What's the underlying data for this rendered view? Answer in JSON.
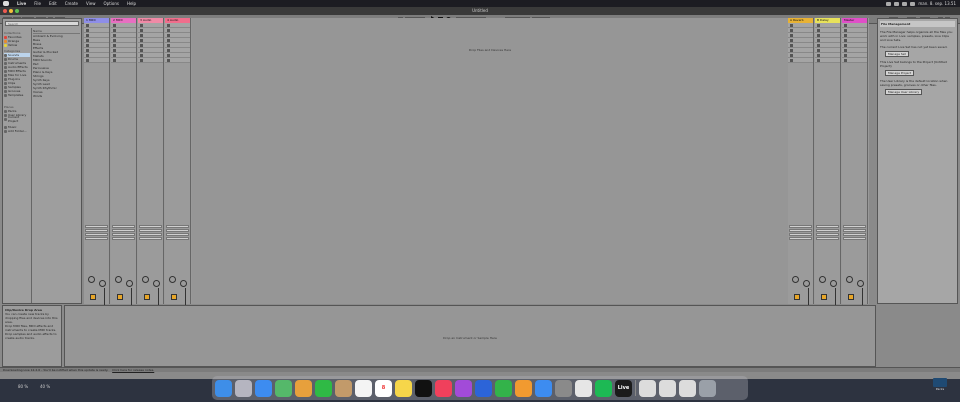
{
  "menubar": {
    "items": [
      "Live",
      "File",
      "Edit",
      "Create",
      "View",
      "Options",
      "Help"
    ],
    "clock": "man. 8. sep. 13.51"
  },
  "window": {
    "title": "Untitled"
  },
  "controlbar": {
    "link": "Link",
    "tap": "Tap",
    "tempo": "120.00",
    "signature": "4 / 4",
    "metronome": "1 Bar",
    "position": "1 . 1 . 1",
    "loop_start": "1 . 1 . 1",
    "loop_len": "4 . 0 . 0",
    "key": "Key",
    "midi": "MIDI",
    "cpu": "0 %"
  },
  "browser": {
    "search_placeholder": "Search",
    "collections_header": "Collections",
    "collections": [
      {
        "label": "Favorites",
        "color": "#e0453a"
      },
      {
        "label": "Orange",
        "color": "#e88b2c"
      },
      {
        "label": "Yellow",
        "color": "#e5d33b"
      }
    ],
    "categories_header": "Categories",
    "categories": [
      "Sounds",
      "Drums",
      "Instruments",
      "Audio Effects",
      "MIDI Effects",
      "Max for Live",
      "Plug-Ins",
      "Clips",
      "Samples",
      "Grooves",
      "Templates"
    ],
    "places_header": "Places",
    "places": [
      "Packs",
      "User Library",
      "Current Project"
    ],
    "places2": [
      "Music",
      "Add Folder..."
    ],
    "name_header": "Name",
    "names": [
      "Ambient & Evolving",
      "Bass",
      "Brass",
      "Effects",
      "Guitar & Plucked",
      "Mallets",
      "MIDI Sounds",
      "Pad",
      "Percussive",
      "Piano & Keys",
      "Strings",
      "Synth Keys",
      "Synth Lead",
      "Synth Rhythmic",
      "Voices",
      "Winds"
    ]
  },
  "tracks": [
    {
      "name": "1 MIDI",
      "color": "#8e8ee8"
    },
    {
      "name": "2 MIDI",
      "color": "#e86fc1"
    },
    {
      "name": "3 Audio",
      "color": "#f08aa6"
    },
    {
      "name": "4 Audio",
      "color": "#f06e8c"
    }
  ],
  "returns": [
    {
      "name": "A Reverb",
      "color": "#e8b234"
    },
    {
      "name": "B Delay",
      "color": "#e8e25a"
    }
  ],
  "master": {
    "name": "Master",
    "color": "#e04fc8"
  },
  "session": {
    "drop_text": "Drop Files and Devices Here",
    "scene_numbers": [
      "1",
      "2",
      "3",
      "4",
      "5",
      "6",
      "7",
      "8"
    ]
  },
  "mixer": {
    "midi_from": "MIDI From",
    "audio_from": "Audio From",
    "all_ins": "All Ins",
    "all_channels": "All Channels",
    "monitor": [
      "In",
      "Auto",
      "Off"
    ],
    "audio_to": "Audio To",
    "master_label": "Master",
    "sends": "Sends",
    "track_numbers": [
      "1",
      "2",
      "3",
      "4"
    ],
    "return_letters": [
      "A",
      "B"
    ],
    "solo": "S",
    "db_values": [
      "-inf",
      "0",
      "-inf",
      "0"
    ]
  },
  "file_manager": {
    "title": "File Management",
    "p1": "The File Manager helps organize all the files you work with in Live: samples, presets, Live Clips and Live Sets.",
    "p2": "The current Live Set has not yet been saved.",
    "btn1": "Manage Set",
    "p3": "This Live Set belongs to the Project [Untitled Project].",
    "btn2": "Manage Project",
    "p4": "The User Library is the default location when saving presets, grooves or other files.",
    "btn3": "Manage User Library"
  },
  "info_view": {
    "title": "Clip/Device Drop Area",
    "p1": "You can create new tracks by dropping files and devices into this area.",
    "p2": "Drop MIDI files, MIDI effects and instruments to create MIDI tracks.",
    "p3": "Drop samples and audio effects to create audio tracks."
  },
  "detail_view": {
    "drop_text": "Drop an Instrument or Sample Here"
  },
  "statusbar": {
    "text": "Downloading Live 12.2.6 - You'll be notified when this update is ready.",
    "link": "Click here for release notes."
  },
  "desktop": {
    "percent_a": "80 %",
    "percent_b": "40 %",
    "packs_label": "Packs"
  },
  "dock": {
    "apps": [
      {
        "name": "finder",
        "color": "#3e8ee8"
      },
      {
        "name": "launchpad",
        "color": "#b5b5c0"
      },
      {
        "name": "mail",
        "color": "#3d8cf0"
      },
      {
        "name": "maps",
        "color": "#55b86a"
      },
      {
        "name": "photos",
        "color": "#e7a03c"
      },
      {
        "name": "facetime",
        "color": "#2fba45"
      },
      {
        "name": "contacts",
        "color": "#c29a6a"
      },
      {
        "name": "reminders",
        "color": "#f4f4f4"
      },
      {
        "name": "calendar",
        "color": "#ffffff"
      },
      {
        "name": "notes",
        "color": "#f6d64a"
      },
      {
        "name": "tv",
        "color": "#111111"
      },
      {
        "name": "music",
        "color": "#f0405c"
      },
      {
        "name": "podcasts",
        "color": "#a24bd8"
      },
      {
        "name": "appletv-app",
        "color": "#2c64d8"
      },
      {
        "name": "numbers",
        "color": "#33b34a"
      },
      {
        "name": "pages",
        "color": "#f19a30"
      },
      {
        "name": "appstore",
        "color": "#3d8cf0"
      },
      {
        "name": "settings",
        "color": "#8a8a8a"
      },
      {
        "name": "chrome",
        "color": "#e6e6e6"
      },
      {
        "name": "spotify",
        "color": "#1db954"
      },
      {
        "name": "live",
        "color": "#1b1b1b"
      }
    ],
    "calendar_day": "8",
    "live_label": "Live",
    "trash": "trash"
  }
}
